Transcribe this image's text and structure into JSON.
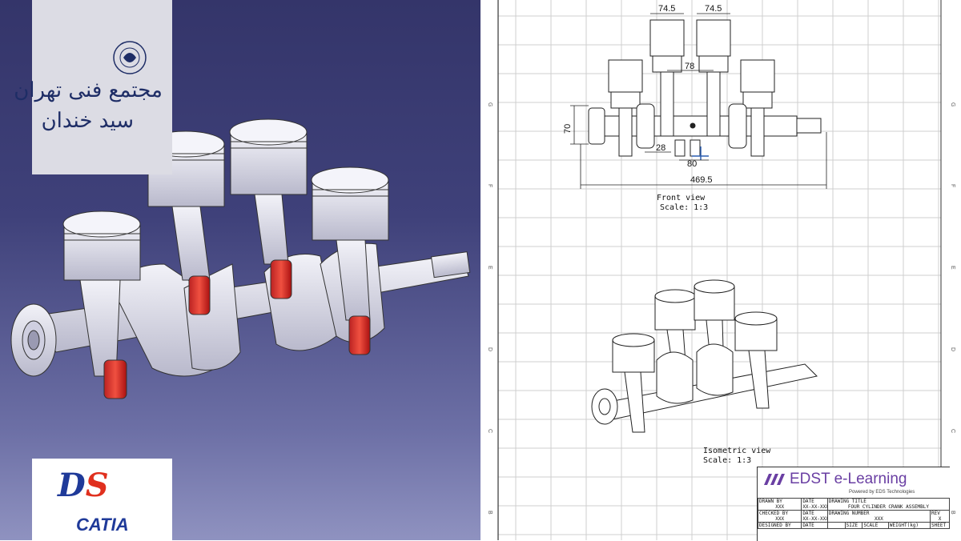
{
  "branding": {
    "institute_line1": "مجتمع فنی تهران",
    "institute_line2": "سید خندان",
    "catia_ds_d": "D",
    "catia_ds_s": "S",
    "catia_name": "CATIA"
  },
  "drawing": {
    "dimensions": {
      "d_top_left": "74.5",
      "d_top_right": "74.5",
      "d_pitch": "78",
      "d_height": "70",
      "d_small": "28",
      "d_mid": "80",
      "d_total": "469.5"
    },
    "front_view": {
      "title": "Front view",
      "scale": "Scale:  1:3"
    },
    "iso_view": {
      "title": "Isometric view",
      "scale": "Scale:  1:3"
    },
    "border_letters": [
      "G",
      "F",
      "E",
      "D",
      "C",
      "B"
    ]
  },
  "title_block": {
    "brand": "EDST e-Learning",
    "powered": "Powered by EDS Technologies",
    "drawn_by_label": "DRAWN BY",
    "drawn_by_value": "XXX",
    "date_label": "DATE",
    "date_value": "XX-XX-XXX",
    "drawing_title_label": "DRAWING TITLE",
    "drawing_title_value": "FOUR CYLINDER CRANK ASSEMBLY",
    "checked_by_label": "CHECKED BY",
    "checked_by_value": "XXX",
    "date2_label": "DATE",
    "date2_value": "XX-XX-XXX",
    "drawing_number_label": "DRAWING NUMBER",
    "drawing_number_value": "XXX",
    "rev_label": "REV",
    "rev_value": "X",
    "designed_by_label": "DESIGNED BY",
    "date3_label": "DATE",
    "size_label": "SIZE",
    "scale_label": "SCALE",
    "weight_label": "WEIGHT(kg)",
    "sheet_label": "SHEET"
  },
  "colors": {
    "left_bg": "#3f417a",
    "accent_red": "#e0301e",
    "catia_blue": "#1f3a99",
    "edst_purple": "#6a3fa3"
  }
}
